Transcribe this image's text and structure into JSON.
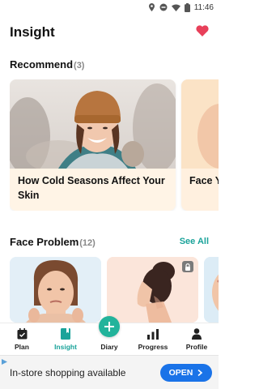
{
  "status_bar": {
    "time": "11:46"
  },
  "header": {
    "title": "Insight"
  },
  "recommend": {
    "title": "Recommend",
    "count": "(3)",
    "cards": [
      {
        "title": "How Cold Seasons Affect Your Skin"
      },
      {
        "title": "Face Y"
      }
    ]
  },
  "face_problem": {
    "title": "Face Problem",
    "count": "(12)",
    "see_all": "See All"
  },
  "nav": {
    "plan": "Plan",
    "insight": "Insight",
    "diary": "Diary",
    "progress": "Progress",
    "profile": "Profile"
  },
  "ad": {
    "text": "In-store shopping available",
    "button": "OPEN"
  },
  "colors": {
    "accent": "#1aa39a",
    "heart": "#e8405a",
    "ad_button": "#1a73e8"
  }
}
